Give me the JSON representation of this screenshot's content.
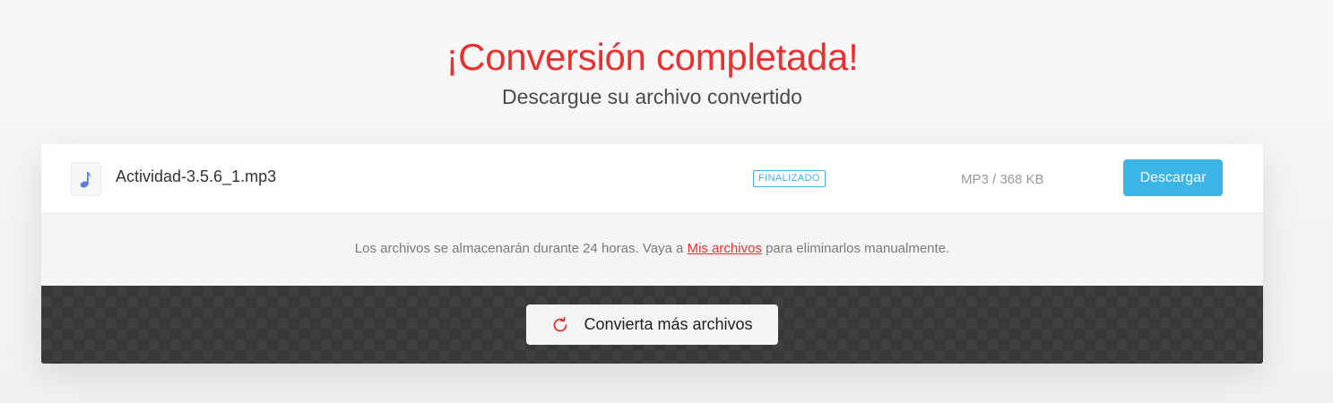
{
  "header": {
    "title": "¡Conversión completada!",
    "subtitle": "Descargue su archivo convertido"
  },
  "file": {
    "icon": "music-note-icon",
    "name": "Actividad-3.5.6_1.mp3",
    "status": "FINALIZADO",
    "info": "MP3 / 368 KB",
    "download_label": "Descargar"
  },
  "note": {
    "before": "Los archivos se almacenarán durante 24 horas. Vaya a ",
    "link": "Mis archivos",
    "after": " para eliminarlos manualmente."
  },
  "actions": {
    "convert_more_label": "Convierta más archivos",
    "convert_more_icon": "refresh-icon"
  },
  "colors": {
    "accent_red": "#e8322f",
    "accent_blue": "#3bb4e6",
    "dark_panel": "#383838"
  }
}
